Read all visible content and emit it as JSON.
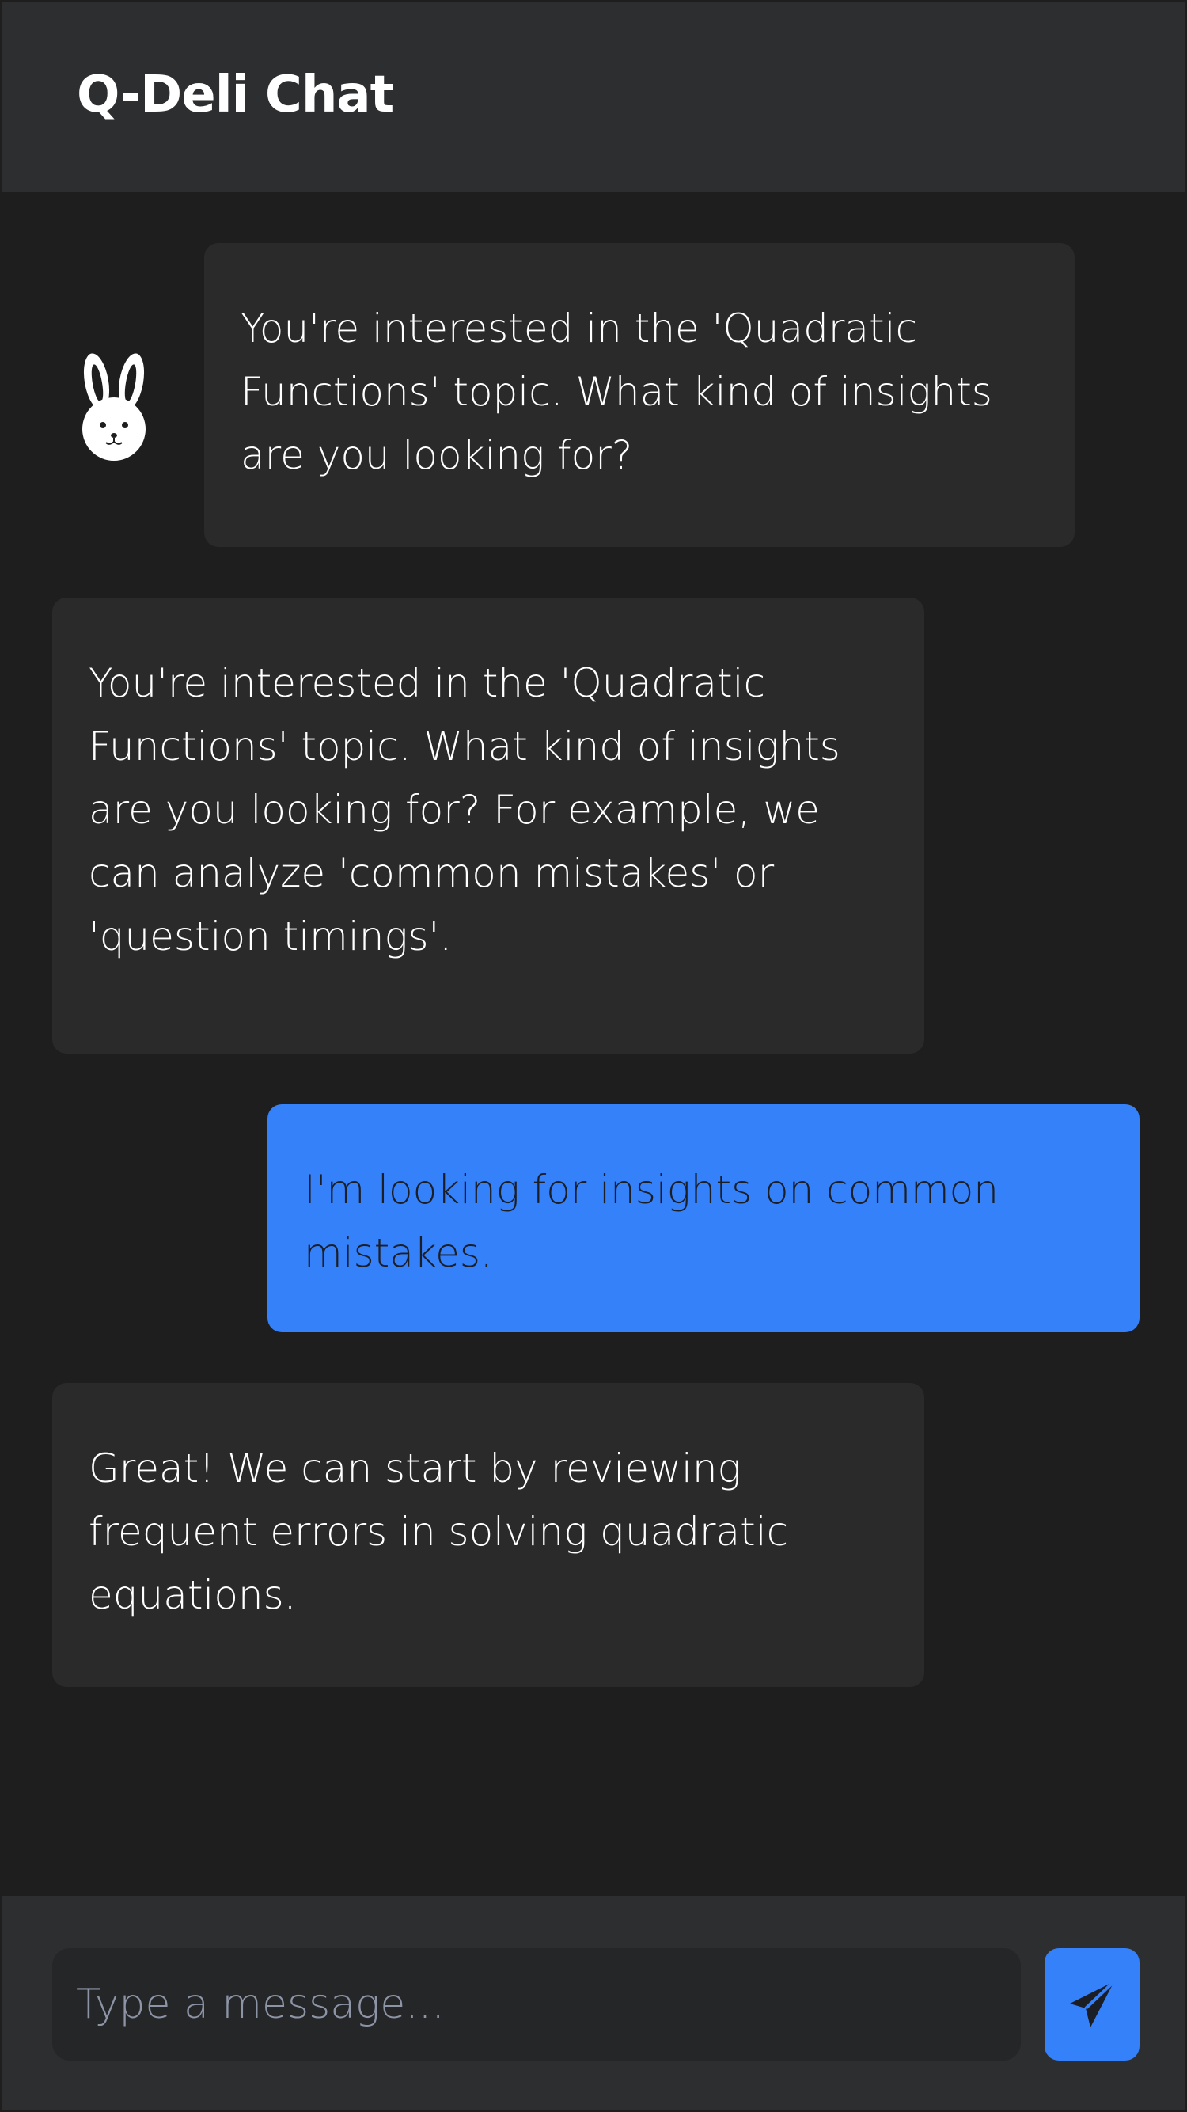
{
  "header": {
    "title": "Q-Deli Chat"
  },
  "messages": [
    {
      "sender": "bot",
      "text": "You're interested in the 'Quadratic Functions' topic. What kind of insights are you looking for?"
    },
    {
      "sender": "bot",
      "text": "You're interested in the 'Quadratic Functions' topic. What kind of insights are you looking for? For example, we can analyze 'common mistakes' or 'question timings'."
    },
    {
      "sender": "user",
      "text": "I'm looking for insights on common mistakes."
    },
    {
      "sender": "bot",
      "text": "Great! We can start by reviewing frequent errors in solving quadratic equations."
    }
  ],
  "composer": {
    "placeholder": "Type a message...",
    "value": "",
    "send_icon": "send-icon"
  },
  "avatar": {
    "icon": "rabbit-icon"
  },
  "colors": {
    "background": "#1e1e1e",
    "header": "#2d2e30",
    "bot_bubble": "#2a2a2a",
    "user_bubble": "#3481f9",
    "input": "#252628",
    "accent": "#3481f9"
  }
}
